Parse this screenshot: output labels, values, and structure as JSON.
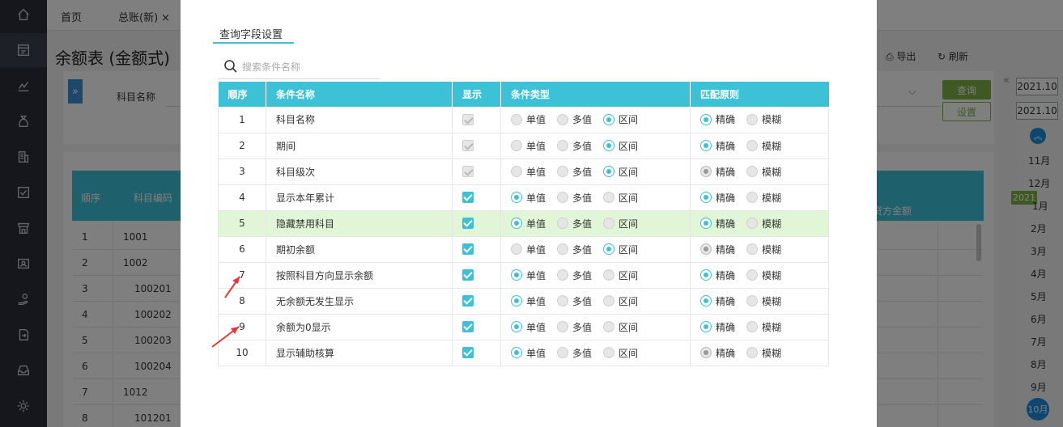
{
  "background": {
    "tabs": [
      {
        "label": "首页"
      },
      {
        "label": "总账(新)",
        "closable": true
      }
    ],
    "page_title": "余额表 (金额式)",
    "toolbar": {
      "export_label": "导出",
      "refresh_label": "刷新"
    },
    "filter": {
      "label": "科目名称",
      "query_label": "查询",
      "settings_label": "设置"
    },
    "table": {
      "headers": [
        "顺序",
        "科目编码",
        "贷方金额"
      ],
      "rows": [
        {
          "seq": "1",
          "code": "1001"
        },
        {
          "seq": "2",
          "code": "1002"
        },
        {
          "seq": "3",
          "code": "100201"
        },
        {
          "seq": "4",
          "code": "100202"
        },
        {
          "seq": "5",
          "code": "100203"
        },
        {
          "seq": "6",
          "code": "100204"
        },
        {
          "seq": "7",
          "code": "1012"
        },
        {
          "seq": "8",
          "code": "101201"
        }
      ]
    },
    "period_panel": {
      "from": "2021.10",
      "to": "2021.10",
      "year_badge": "2021",
      "months": [
        "11月",
        "12月",
        "1月",
        "2月",
        "3月",
        "4月",
        "5月",
        "6月",
        "7月",
        "8月",
        "9月"
      ],
      "current_month": "10月"
    }
  },
  "modal": {
    "tab_label": "查询字段设置",
    "search_placeholder": "搜索条件名称",
    "columns": [
      "顺序",
      "条件名称",
      "显示",
      "条件类型",
      "匹配原则"
    ],
    "type_options": [
      "单值",
      "多值",
      "区间"
    ],
    "match_options": [
      "精确",
      "模糊"
    ],
    "rows": [
      {
        "seq": "1",
        "name": "科目名称",
        "show": true,
        "show_disabled": true,
        "type": "区间",
        "match": "精确",
        "match_disabled": false,
        "highlight": false
      },
      {
        "seq": "2",
        "name": "期间",
        "show": true,
        "show_disabled": true,
        "type": "区间",
        "match": "精确",
        "match_disabled": false,
        "highlight": false
      },
      {
        "seq": "3",
        "name": "科目级次",
        "show": true,
        "show_disabled": true,
        "type": "区间",
        "match": "精确",
        "match_disabled": true,
        "highlight": false
      },
      {
        "seq": "4",
        "name": "显示本年累计",
        "show": true,
        "show_disabled": false,
        "type": "单值",
        "match": "精确",
        "match_disabled": false,
        "highlight": false
      },
      {
        "seq": "5",
        "name": "隐藏禁用科目",
        "show": true,
        "show_disabled": false,
        "type": "单值",
        "match": "精确",
        "match_disabled": false,
        "highlight": true
      },
      {
        "seq": "6",
        "name": "期初余额",
        "show": true,
        "show_disabled": false,
        "type": "区间",
        "match": "精确",
        "match_disabled": true,
        "highlight": false
      },
      {
        "seq": "7",
        "name": "按照科目方向显示余额",
        "show": true,
        "show_disabled": false,
        "type": "单值",
        "match": "精确",
        "match_disabled": false,
        "highlight": false
      },
      {
        "seq": "8",
        "name": "无余额无发生显示",
        "show": true,
        "show_disabled": false,
        "type": "单值",
        "match": "精确",
        "match_disabled": false,
        "highlight": false
      },
      {
        "seq": "9",
        "name": "余额为0显示",
        "show": true,
        "show_disabled": false,
        "type": "单值",
        "match": "精确",
        "match_disabled": false,
        "highlight": false
      },
      {
        "seq": "10",
        "name": "显示辅助核算",
        "show": true,
        "show_disabled": false,
        "type": "单值",
        "match": "精确",
        "match_disabled": true,
        "highlight": false
      }
    ]
  },
  "colors": {
    "accent": "#3dc1d7",
    "highlight_row": "#e0f6d6",
    "annotation_arrow": "#e53935",
    "sidebar": "#2b2f3a"
  }
}
